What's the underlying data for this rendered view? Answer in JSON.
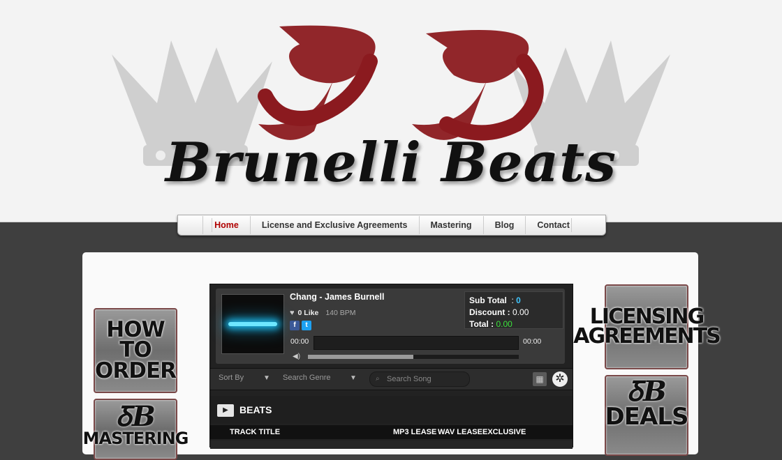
{
  "brand": {
    "name": "Brunelli Beats"
  },
  "nav": {
    "items": [
      {
        "label": "Home",
        "active": true
      },
      {
        "label": "License and Exclusive Agreements",
        "active": false
      },
      {
        "label": "Mastering",
        "active": false
      },
      {
        "label": "Blog",
        "active": false
      },
      {
        "label": "Contact",
        "active": false
      }
    ]
  },
  "sidebar_left": {
    "how_to_order": {
      "line1": "HOW TO",
      "line2": "ORDER"
    },
    "mastering": {
      "line1": "MASTERING"
    }
  },
  "sidebar_right": {
    "licensing": {
      "line1": "LICENSING",
      "line2": "AGREEMENTS"
    },
    "deals": {
      "line1": "DEALS"
    }
  },
  "player": {
    "track_title": "Chang - James Burnell",
    "likes": "0 Like",
    "bpm": "140 BPM",
    "time_current": "00:00",
    "time_total": "00:00",
    "volume_level": 0.5,
    "social": {
      "facebook": "f",
      "twitter": "t"
    },
    "totals": {
      "subtotal_label": "Sub Total",
      "subtotal_value": "0",
      "discount_label": "Discount :",
      "discount_value": "0.00",
      "total_label": "Total :",
      "total_value": "0.00"
    },
    "filters": {
      "sort_by": "Sort By",
      "search_genre": "Search Genre",
      "search_song_placeholder": "Search Song"
    },
    "section_title": "BEATS",
    "columns": {
      "track_title": "TRACK TITLE",
      "mp3_lease": "MP3 LEASE",
      "wav_lease": "WAV LEASE",
      "exclusive": "EXCLUSIVE"
    }
  },
  "colors": {
    "accent_red": "#b00000",
    "logo_red": "#8b1a1f",
    "subtotal_blue": "#3fc6ff",
    "total_green": "#3ce23c"
  }
}
